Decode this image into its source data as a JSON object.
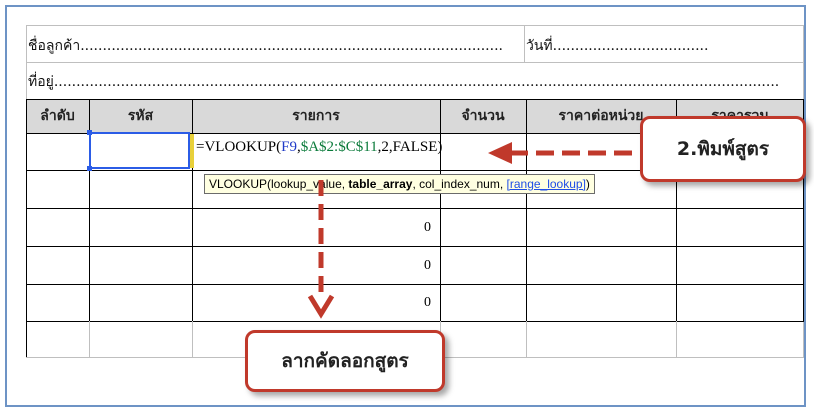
{
  "form": {
    "customer_label": "ชื่อลูกค้า",
    "customer_dots": "...............................................................................................",
    "date_label": "วันที่",
    "date_dots": "...................................",
    "address_label": "ที่อยู่",
    "address_dots": "..................................................................................................................................................................."
  },
  "table": {
    "headers": [
      "ลำดับ",
      "รหัส",
      "รายการ",
      "จำนวน",
      "ราคาต่อหน่วย",
      "ราคารวม"
    ],
    "zero_values": [
      "0",
      "0",
      "0"
    ]
  },
  "formula": {
    "prefix": "=VLOOKUP(",
    "arg1": "F9",
    "comma1": ",",
    "arg2": "$A$2:$C$11",
    "rest": ",2,FALSE)"
  },
  "tooltip": {
    "func": "VLOOKUP(lookup_value, ",
    "bold_arg": "table_array",
    "middle": ", col_index_num, ",
    "link": "[range_lookup]",
    "end": ")"
  },
  "callouts": {
    "type_formula": "2.พิมพ์สูตร",
    "drag_formula": "ลากคัดลอกสูตร"
  },
  "colors": {
    "accent_red": "#c0392b",
    "header_gray": "#d9d9d9",
    "frame_blue": "#6d93c5",
    "selection_blue": "#2b5ce6"
  }
}
